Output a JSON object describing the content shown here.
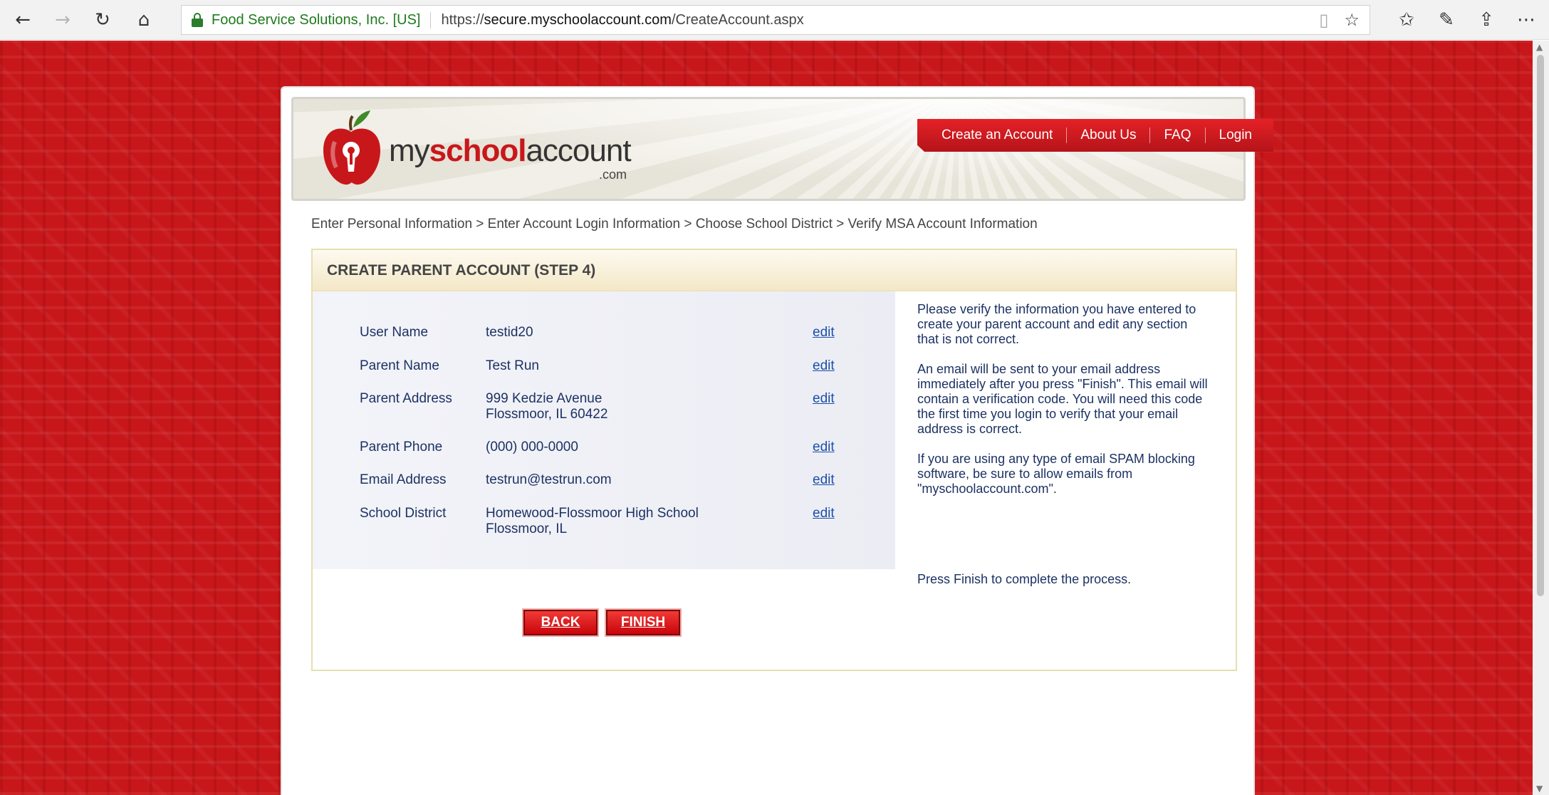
{
  "browser": {
    "site_identity": "Food Service Solutions, Inc. [US]",
    "url_prefix": "https://",
    "url_host": "secure.myschoolaccount.com",
    "url_path": "/CreateAccount.aspx"
  },
  "logo": {
    "text_my": "my",
    "text_school": "school",
    "text_account": "account",
    "text_com": ".com"
  },
  "nav": [
    "Create an Account",
    "About Us",
    "FAQ",
    "Login"
  ],
  "breadcrumb": "Enter Personal Information > Enter Account Login Information > Choose School District > Verify MSA Account Information",
  "step_title": "CREATE PARENT ACCOUNT (STEP 4)",
  "fields": [
    {
      "label": "User Name",
      "value": "testid20",
      "value2": "",
      "edit": "edit"
    },
    {
      "label": "Parent Name",
      "value": "Test Run",
      "value2": "",
      "edit": "edit"
    },
    {
      "label": "Parent Address",
      "value": "999 Kedzie Avenue",
      "value2": "Flossmoor, IL 60422",
      "edit": "edit"
    },
    {
      "label": "Parent Phone",
      "value": "(000) 000-0000",
      "value2": "",
      "edit": "edit"
    },
    {
      "label": "Email Address",
      "value": "testrun@testrun.com",
      "value2": "",
      "edit": "edit"
    },
    {
      "label": "School District",
      "value": "Homewood-Flossmoor High School",
      "value2": "Flossmoor, IL",
      "edit": "edit"
    }
  ],
  "help": {
    "p1": "Please verify the information you have entered to create your parent account and edit any section that is not correct.",
    "p2": "An email will be sent to your email address immediately after you press \"Finish\". This email will contain a verification code. You will need this code the first time you login to verify that your email address is correct.",
    "p3": "If you are using any type of email SPAM blocking software, be sure to allow emails from \"myschoolaccount.com\".",
    "p4": "Press Finish to complete the process."
  },
  "buttons": {
    "back": "BACK",
    "finish": "FINISH"
  },
  "colors": {
    "brand_red": "#c8171b",
    "link_blue": "#1a4fa8",
    "text_navy": "#1c3263"
  }
}
